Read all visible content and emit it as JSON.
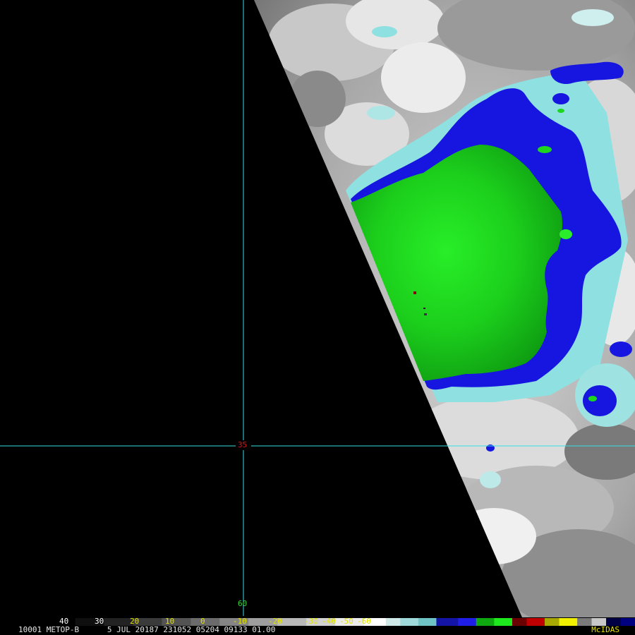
{
  "image": {
    "satellite": "METOP-B",
    "frame": "1",
    "area": "0001",
    "date": "5 JUL 20187",
    "time": "231052",
    "line_res": "05204",
    "elem_res": "09133",
    "band": "01.00",
    "software": "McIDAS"
  },
  "grid": {
    "latitude_label": "35",
    "longitude_label": "60",
    "color": "#33e0e0"
  },
  "colorbar": {
    "tick_labels": [
      "40",
      "30",
      "20",
      "10",
      "0",
      "-10",
      "-20",
      "-30",
      "-40",
      "-50",
      "-60"
    ],
    "segments": [
      {
        "color": "#000000",
        "units": 13
      },
      {
        "color": "#0f0f0f",
        "units": 8
      },
      {
        "color": "#222222",
        "units": 8
      },
      {
        "color": "#3a3a3a",
        "units": 8
      },
      {
        "color": "#535353",
        "units": 8
      },
      {
        "color": "#6b6b6b",
        "units": 8
      },
      {
        "color": "#858585",
        "units": 8
      },
      {
        "color": "#9e9e9e",
        "units": 8
      },
      {
        "color": "#b8b8b8",
        "units": 8
      },
      {
        "color": "#d2d2d2",
        "units": 8
      },
      {
        "color": "#ececec",
        "units": 8
      },
      {
        "color": "#ffffff",
        "units": 6
      },
      {
        "color": "#cfe8e8",
        "units": 4
      },
      {
        "color": "#9fd9d9",
        "units": 5
      },
      {
        "color": "#6ec4c4",
        "units": 5
      },
      {
        "color": "#1414a6",
        "units": 6
      },
      {
        "color": "#1e1ee8",
        "units": 5
      },
      {
        "color": "#10a810",
        "units": 5
      },
      {
        "color": "#1ee81e",
        "units": 5
      },
      {
        "color": "#6a0000",
        "units": 4
      },
      {
        "color": "#c00000",
        "units": 5
      },
      {
        "color": "#a8a800",
        "units": 4
      },
      {
        "color": "#f0f000",
        "units": 5
      },
      {
        "color": "#7a7a7a",
        "units": 4
      },
      {
        "color": "#c8c8c8",
        "units": 4
      },
      {
        "color": "#000044",
        "units": 4
      },
      {
        "color": "#000080",
        "units": 4
      }
    ]
  },
  "colors": {
    "cloud_blue": "#1616e0",
    "cloud_green": "#1ed61e",
    "cloud_green_dark": "#0f9a12",
    "cyan_edge": "#8fe0e0",
    "background": "#000000"
  }
}
